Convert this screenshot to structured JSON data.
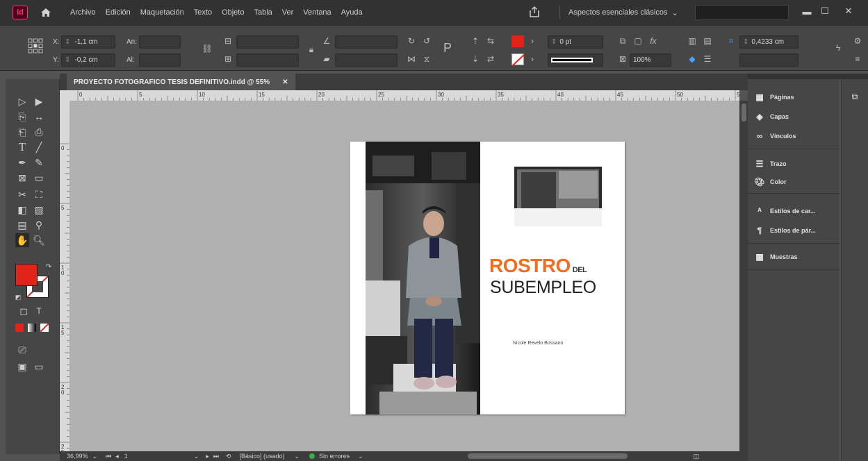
{
  "app": {
    "logo": "Id",
    "workspace": "Aspectos esenciales clásicos"
  },
  "menu": [
    "Archivo",
    "Edición",
    "Maquetación",
    "Texto",
    "Objeto",
    "Tabla",
    "Ver",
    "Ventana",
    "Ayuda"
  ],
  "control": {
    "x_label": "X:",
    "x_value": "-1,1 cm",
    "y_label": "Y:",
    "y_value": "-0,2 cm",
    "w_label": "An:",
    "h_label": "Al:",
    "stroke_weight": "0 pt",
    "scale": "100%",
    "spacing": "0,4233 cm"
  },
  "document": {
    "tab_title": "PROYECTO FOTOGRAFICO TESIS DEFINITIVO.indd @ 55%",
    "ruler_h": [
      "0",
      "5",
      "10",
      "15",
      "20",
      "25",
      "30",
      "35",
      "40",
      "45",
      "50",
      "55"
    ],
    "ruler_v": [
      "0",
      "5",
      "1\n0",
      "1\n5",
      "2\n0",
      "2\n5"
    ]
  },
  "cover": {
    "title_word1": "ROSTRO",
    "title_del": "DEL",
    "title_word2": "SUBEMPLEO",
    "author": "Nicole Revelo Bossano"
  },
  "status": {
    "zoom": "36,99%",
    "page": "1",
    "style": "[Básico] (usado)",
    "preflight": "Sin errores"
  },
  "panels": [
    {
      "label": "Páginas",
      "icon": "pages-icon"
    },
    {
      "label": "Capas",
      "icon": "layers-icon"
    },
    {
      "label": "Vínculos",
      "icon": "links-icon"
    },
    {
      "label": "Trazo",
      "icon": "stroke-icon"
    },
    {
      "label": "Color",
      "icon": "color-icon"
    },
    {
      "label": "Estilos de car...",
      "icon": "char-styles-icon"
    },
    {
      "label": "Estilos de pár...",
      "icon": "para-styles-icon"
    },
    {
      "label": "Muestras",
      "icon": "swatches-icon"
    }
  ],
  "colors": {
    "fill": "#e2231a",
    "accent_orange": "#f26d21",
    "preflight_ok": "#35b34a"
  }
}
